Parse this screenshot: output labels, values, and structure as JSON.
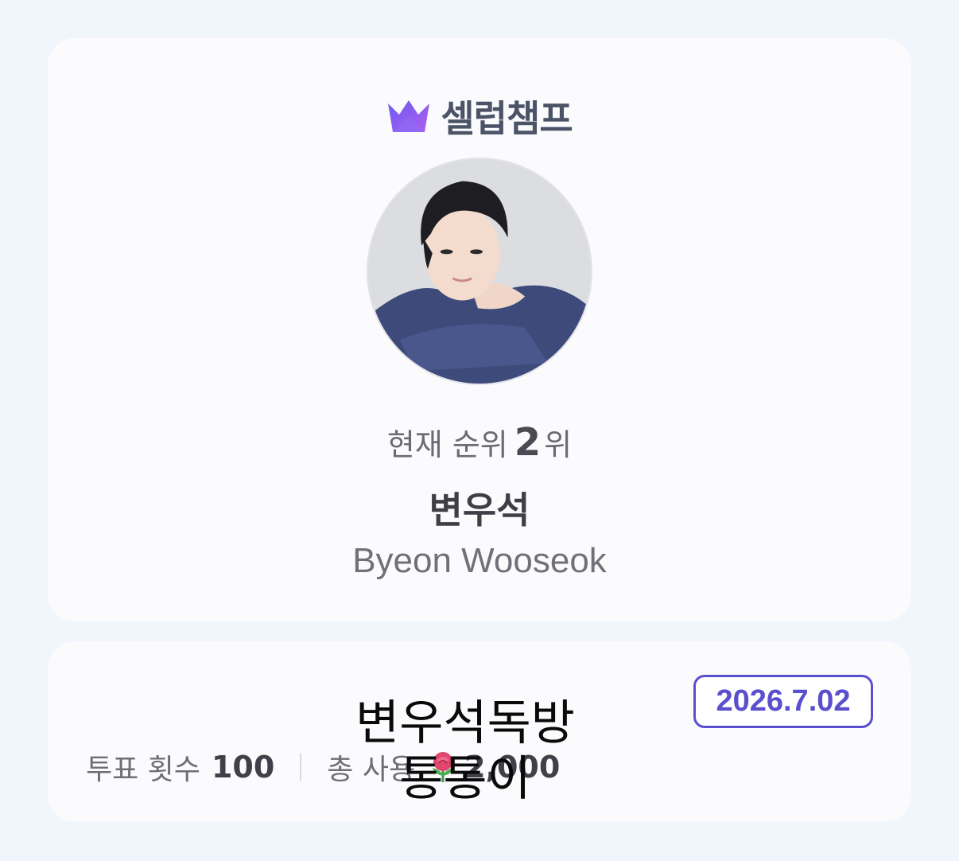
{
  "brand": {
    "name": "셀럽챔프",
    "icon": "crown-icon"
  },
  "profile": {
    "rank_label": "현재 순위",
    "rank_number": "2",
    "rank_suffix": "위",
    "name_ko": "변우석",
    "name_en": "Byeon Wooseok",
    "avatar_icon": "profile-photo"
  },
  "vote_info": {
    "date": "2026.7.02",
    "vote_count_label": "투표 횟수",
    "vote_count": "100",
    "total_used_label": "총 사용",
    "total_used_icon": "rose-icon",
    "total_used": "2,000"
  },
  "overlay": {
    "line1": "변우석독방",
    "line2": "통통이"
  },
  "colors": {
    "accent": "#5a4fcf",
    "background": "#f1f5fc",
    "card": "#fbfbfe"
  }
}
